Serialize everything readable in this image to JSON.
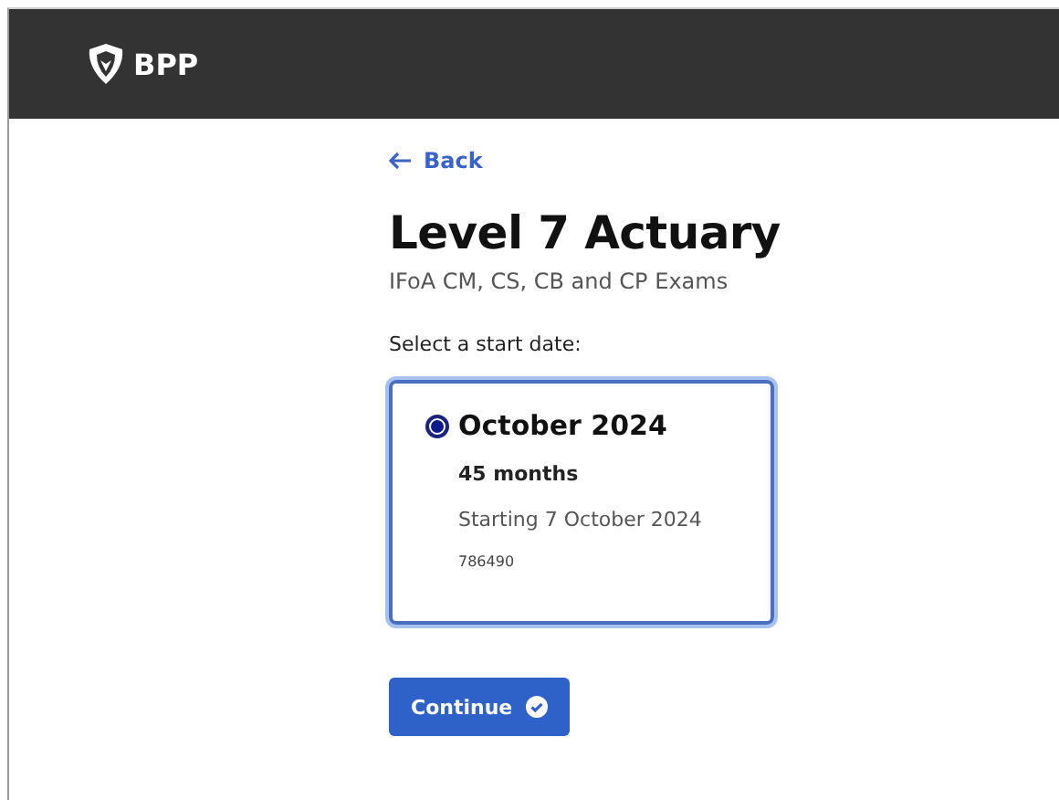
{
  "header": {
    "brand": "BPP"
  },
  "back": {
    "label": "Back"
  },
  "title": "Level 7 Actuary",
  "subtitle": "IFoA CM, CS, CB and CP Exams",
  "prompt": "Select a start date:",
  "options": [
    {
      "title": "October 2024",
      "duration": "45 months",
      "start": "Starting 7 October 2024",
      "code": "786490",
      "selected": true
    }
  ],
  "continue": {
    "label": "Continue"
  }
}
